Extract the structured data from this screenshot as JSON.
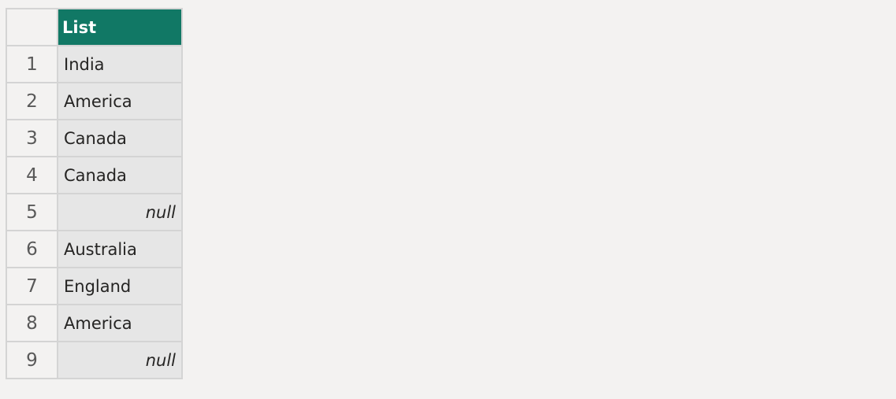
{
  "table": {
    "columns": [
      "List"
    ],
    "rows": [
      {
        "index": "1",
        "value": "India",
        "is_null": false
      },
      {
        "index": "2",
        "value": "America",
        "is_null": false
      },
      {
        "index": "3",
        "value": "Canada",
        "is_null": false
      },
      {
        "index": "4",
        "value": "Canada",
        "is_null": false
      },
      {
        "index": "5",
        "value": "null",
        "is_null": true
      },
      {
        "index": "6",
        "value": "Australia",
        "is_null": false
      },
      {
        "index": "7",
        "value": "England",
        "is_null": false
      },
      {
        "index": "8",
        "value": "America",
        "is_null": false
      },
      {
        "index": "9",
        "value": "null",
        "is_null": true
      }
    ]
  },
  "colors": {
    "header_bg": "#117865",
    "cell_bg": "#e6e6e6",
    "page_bg": "#f3f2f1"
  }
}
